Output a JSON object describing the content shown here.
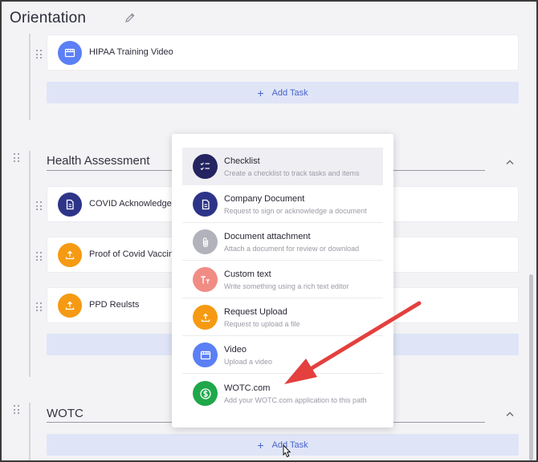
{
  "page": {
    "title": "Orientation"
  },
  "sections": {
    "orientation": {
      "tasks": [
        {
          "label": "HIPAA Training Video",
          "icon": "video-icon",
          "color": "#5b7ff5"
        }
      ],
      "add_task_label": "Add Task"
    },
    "health": {
      "title": "Health Assessment",
      "tasks": [
        {
          "label": "COVID Acknowledgem",
          "icon": "document-icon",
          "color": "#2d3488"
        },
        {
          "label": "Proof of Covid Vaccina",
          "icon": "upload-icon",
          "color": "#f59a12"
        },
        {
          "label": "PPD Reulsts",
          "icon": "upload-icon",
          "color": "#f59a12"
        }
      ]
    },
    "wotc": {
      "title": "WOTC",
      "add_task_label": "Add Task"
    }
  },
  "menu": {
    "items": [
      {
        "title": "Checklist",
        "desc": "Create a checklist to track tasks and items",
        "icon": "checklist-icon",
        "color": "#242461"
      },
      {
        "title": "Company Document",
        "desc": "Request to sign or acknowledge a document",
        "icon": "document-icon",
        "color": "#2d3488"
      },
      {
        "title": "Document attachment",
        "desc": "Attach a document for review or download",
        "icon": "paperclip-icon",
        "color": "#b2b2bc"
      },
      {
        "title": "Custom text",
        "desc": "Write something using a rich text editor",
        "icon": "text-icon",
        "color": "#f08c84"
      },
      {
        "title": "Request Upload",
        "desc": "Request to upload a file",
        "icon": "upload-icon",
        "color": "#f59a12"
      },
      {
        "title": "Video",
        "desc": "Upload a video",
        "icon": "video-icon",
        "color": "#5b7ff5"
      },
      {
        "title": "WOTC.com",
        "desc": "Add your WOTC.com application to this path",
        "icon": "dollar-icon",
        "color": "#1fa84a"
      }
    ]
  },
  "annotation": {
    "arrow_color": "#e3403e"
  }
}
